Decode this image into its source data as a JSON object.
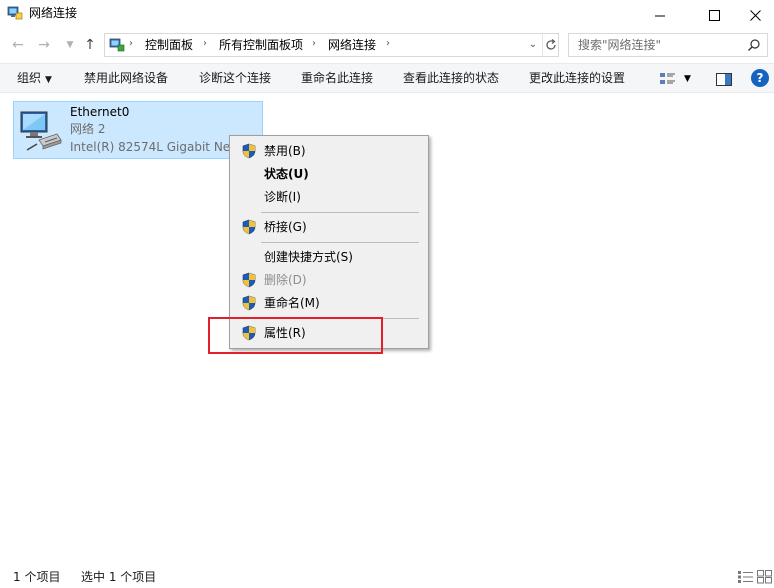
{
  "window": {
    "title": "网络连接"
  },
  "address": {
    "crumbs": [
      "控制面板",
      "所有控制面板项",
      "网络连接"
    ]
  },
  "search": {
    "placeholder": "搜索\"网络连接\""
  },
  "toolbar": {
    "organize": "组织",
    "items": [
      "禁用此网络设备",
      "诊断这个连接",
      "重命名此连接",
      "查看此连接的状态",
      "更改此连接的设置"
    ],
    "help": "?"
  },
  "connection": {
    "name": "Ethernet0",
    "network": "网络 2",
    "device": "Intel(R) 82574L Gigabit Network Connection"
  },
  "context_menu": {
    "items": [
      {
        "label": "禁用(B)"
      },
      {
        "label": "状态(U)"
      },
      {
        "label": "诊断(I)"
      },
      {
        "label": "桥接(G)"
      },
      {
        "label": "创建快捷方式(S)"
      },
      {
        "label": "删除(D)"
      },
      {
        "label": "重命名(M)"
      },
      {
        "label": "属性(R)"
      }
    ]
  },
  "status": {
    "count": "1 个项目",
    "selected": "选中 1 个项目"
  },
  "colors": {
    "selection_bg": "#cce8ff",
    "selection_border": "#99d1ff",
    "highlight_box": "#e0202a",
    "help_blue": "#1565c0"
  }
}
